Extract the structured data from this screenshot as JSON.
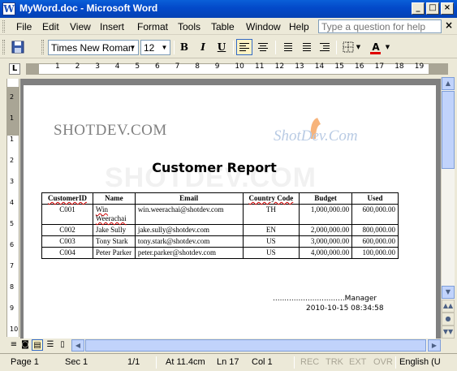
{
  "window": {
    "title": "MyWord.doc - Microsoft Word",
    "app_icon": "W",
    "minimize": "_",
    "restore": "□",
    "close": "×"
  },
  "menu": {
    "items": [
      "File",
      "Edit",
      "View",
      "Insert",
      "Format",
      "Tools",
      "Table",
      "Window",
      "Help"
    ],
    "help_placeholder": "Type a question for help",
    "help_close": "×"
  },
  "toolbar": {
    "font_name": "Times New Roman",
    "font_size": "12",
    "bold": "B",
    "italic": "I",
    "underline": "U",
    "font_color_label": "A"
  },
  "ruler": {
    "corner": "L",
    "numbers": [
      "1",
      "2",
      "3",
      "4",
      "5",
      "6",
      "7",
      "8",
      "9",
      "10",
      "11",
      "12",
      "13",
      "14",
      "15",
      "16",
      "17",
      "18",
      "19"
    ],
    "vertical_numbers": [
      "2",
      "1",
      "1",
      "2",
      "3",
      "4",
      "5",
      "6",
      "7",
      "8",
      "9",
      "10"
    ]
  },
  "document": {
    "logo_text": "SHOTDEV.COM",
    "logo_graphic": "ShotDev.Com",
    "watermark": "SHOTDEV.COM",
    "report_title": "Customer Report",
    "columns": [
      "CustomerID",
      "Name",
      "Email",
      "Country Code",
      "Budget",
      "Used"
    ],
    "rows": [
      [
        "C001",
        "Win Weerachai",
        "win.weerachai@shotdev.com",
        "TH",
        "1,000,000.00",
        "600,000.00"
      ],
      [
        "C002",
        "Jake Sully",
        "jake.sully@shotdev.com",
        "EN",
        "2,000,000.00",
        "800,000.00"
      ],
      [
        "C003",
        "Tony Stark",
        "tony.stark@shotdev.com",
        "US",
        "3,000,000.00",
        "600,000.00"
      ],
      [
        "C004",
        "Peter Parker",
        "peter.parker@shotdev.com",
        "US",
        "4,000,000.00",
        "100,000.00"
      ]
    ],
    "manager_line": "...............................Manager",
    "timestamp": "2010-10-15 08:34:58"
  },
  "status": {
    "page": "Page 1",
    "section": "Sec 1",
    "page_of": "1/1",
    "at": "At 11.4cm",
    "line": "Ln 17",
    "col": "Col 1",
    "rec": "REC",
    "trk": "TRK",
    "ext": "EXT",
    "ovr": "OVR",
    "language": "English (U"
  },
  "colors": {
    "titlebar": "#0349c9",
    "chrome": "#ece9d8",
    "font_color": "#e00000"
  }
}
